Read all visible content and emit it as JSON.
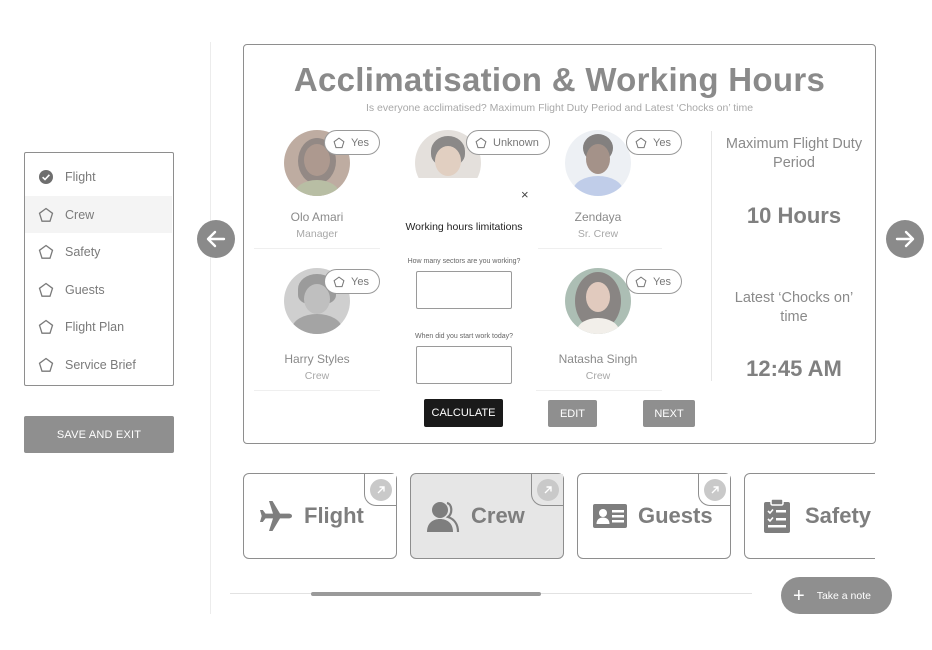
{
  "sidebar": {
    "items": [
      {
        "label": "Flight",
        "icon": "check-circle-icon"
      },
      {
        "label": "Crew",
        "icon": "pentagon-icon",
        "active": true
      },
      {
        "label": "Safety",
        "icon": "pentagon-icon"
      },
      {
        "label": "Guests",
        "icon": "pentagon-icon"
      },
      {
        "label": "Flight Plan",
        "icon": "pentagon-icon"
      },
      {
        "label": "Service Brief",
        "icon": "pentagon-icon"
      }
    ],
    "save_label": "SAVE AND EXIT"
  },
  "panel": {
    "title": "Acclimatisation & Working Hours",
    "subtitle": "Is everyone acclimatised? Maximum Flight Duty Period and Latest ‘Chocks on’ time"
  },
  "crew": [
    {
      "name": "Olo Amari",
      "role": "Manager",
      "status": "Yes"
    },
    {
      "name": "",
      "role": "",
      "status": "Unknown"
    },
    {
      "name": "Zendaya",
      "role": "Sr. Crew",
      "status": "Yes"
    },
    {
      "name": "Harry Styles",
      "role": "Crew",
      "status": "Yes"
    },
    {
      "name": "Natasha Singh",
      "role": "Crew",
      "status": "Yes"
    }
  ],
  "stats": {
    "fdp_label": "Maximum Flight Duty Period",
    "fdp_value": "10 Hours",
    "chocks_label": "Latest ‘Chocks on’ time",
    "chocks_value": "12:45 AM"
  },
  "modal": {
    "close": "×",
    "title": "Working hours limitations",
    "q1": "How many sectors are you working?",
    "q1_value": "",
    "q2": "When did you start work today?",
    "q2_value": ""
  },
  "actions": {
    "calculate": "CALCULATE",
    "edit": "EDIT",
    "next": "NEXT"
  },
  "cards": [
    {
      "label": "Flight",
      "icon": "airplane-icon"
    },
    {
      "label": "Crew",
      "icon": "crew-icon",
      "selected": true
    },
    {
      "label": "Guests",
      "icon": "id-card-icon"
    },
    {
      "label": "Safety",
      "icon": "clipboard-icon"
    }
  ],
  "note_label": "Take a note",
  "colors": {
    "accent": "#8a8a8a",
    "dark": "#1a1a1a",
    "selected": "#e6e6e6"
  }
}
